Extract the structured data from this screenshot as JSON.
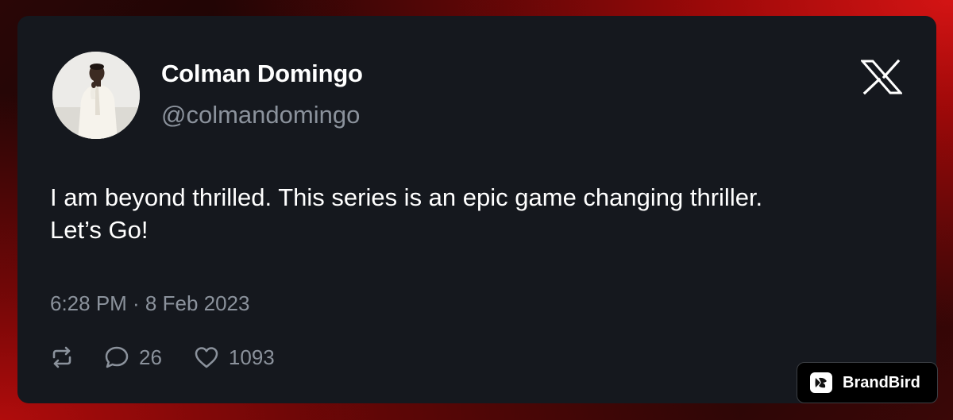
{
  "tweet": {
    "author_name": "Colman Domingo",
    "author_handle": "@colmandomingo",
    "text_lines": [
      "I am beyond thrilled. This series is an epic game changing thriller.",
      "Let’s Go!"
    ],
    "timestamp": "6:28 PM · 8 Feb 2023",
    "reply_count": "26",
    "like_count": "1093"
  },
  "icons": {
    "platform": "x-logo-icon",
    "retweet": "retweet-icon",
    "reply": "reply-icon",
    "like": "heart-icon",
    "brand": "brandbird-logo-icon"
  },
  "badge": {
    "label": "BrandBird"
  },
  "colors": {
    "card_background": "#15181e",
    "primary_text": "#ffffff",
    "secondary_text": "#8b929c",
    "background_accent": "#c81414"
  }
}
